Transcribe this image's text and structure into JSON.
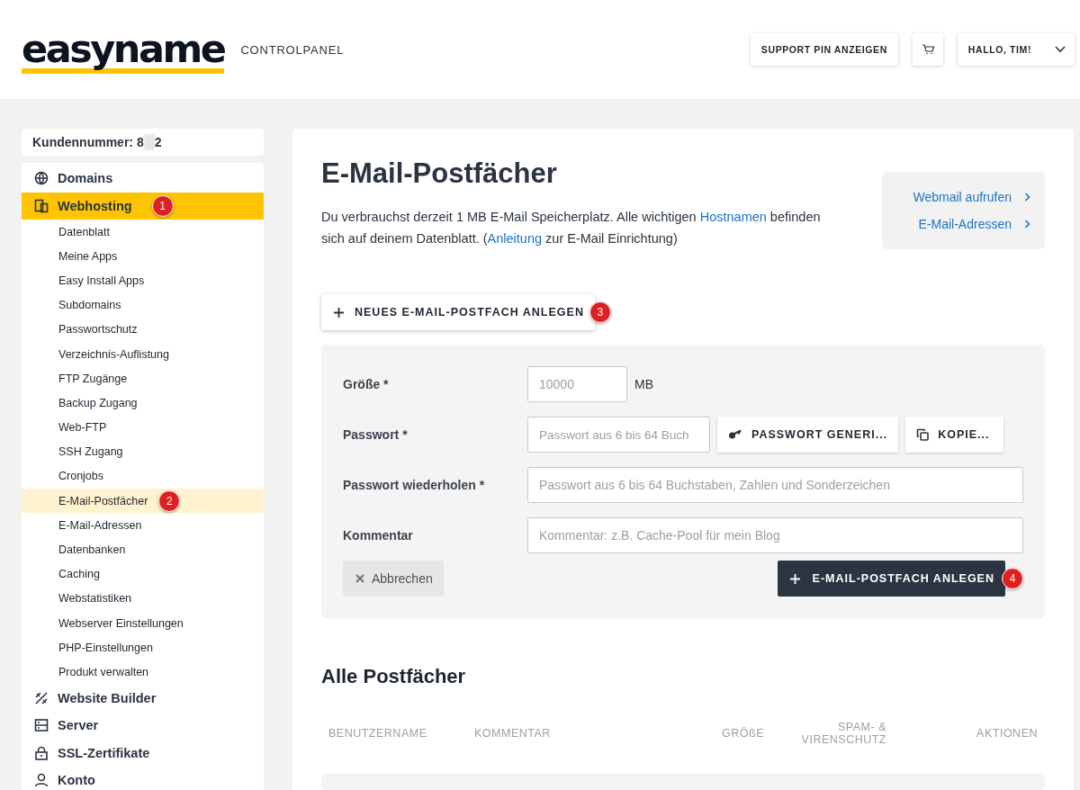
{
  "header": {
    "logo": "easyname",
    "product": "CONTROLPANEL",
    "buttons": [
      {
        "kind": "text",
        "label": "SUPPORT PIN ANZEIGEN"
      },
      {
        "kind": "cart"
      },
      {
        "kind": "menu",
        "label": "HALLO, TIM!"
      }
    ]
  },
  "sidebar": {
    "customer_label": "Kundennummer: 8",
    "customer_suffix": "2",
    "items": [
      {
        "label": "Domains",
        "kind": "globe",
        "selected": false
      },
      {
        "label": "Webhosting",
        "kind": "pages",
        "selected": true,
        "marker": "1",
        "children": [
          {
            "label": "Datenblatt",
            "selected": false
          },
          {
            "label": "Meine Apps",
            "selected": false
          },
          {
            "label": "Easy Install Apps",
            "selected": false
          },
          {
            "label": "Subdomains",
            "selected": false
          },
          {
            "label": "Passwortschutz",
            "selected": false
          },
          {
            "label": "Verzeichnis-Auflistung",
            "selected": false
          },
          {
            "label": "FTP Zugänge",
            "selected": false
          },
          {
            "label": "Backup Zugang",
            "selected": false
          },
          {
            "label": "Web-FTP",
            "selected": false
          },
          {
            "label": "SSH Zugang",
            "selected": false
          },
          {
            "label": "Cronjobs",
            "selected": false
          },
          {
            "label": "E-Mail-Postfächer",
            "selected": true,
            "marker": "2"
          },
          {
            "label": "E-Mail-Adressen",
            "selected": false
          },
          {
            "label": "Datenbanken",
            "selected": false
          },
          {
            "label": "Caching",
            "selected": false
          },
          {
            "label": "Webstatistiken",
            "selected": false
          },
          {
            "label": "Webserver Einstellungen",
            "selected": false
          },
          {
            "label": "PHP-Einstellungen",
            "selected": false
          },
          {
            "label": "Produkt verwalten",
            "selected": false
          }
        ]
      },
      {
        "label": "Website Builder",
        "kind": "tools",
        "selected": false
      },
      {
        "label": "Server",
        "kind": "server",
        "selected": false
      },
      {
        "label": "SSL-Zertifikate",
        "kind": "lock",
        "selected": false
      },
      {
        "label": "Konto",
        "kind": "user",
        "selected": false
      }
    ]
  },
  "main": {
    "title": "E-Mail-Postfächer",
    "intro": [
      {
        "kind": "text",
        "text": "Du verbrauchst derzeit 1 MB E-Mail Speicherplatz. Alle wichtigen "
      },
      {
        "kind": "link",
        "text": "Hostnamen"
      },
      {
        "kind": "text",
        "text": " befinden sich auf deinem Datenblatt. ("
      },
      {
        "kind": "link",
        "text": "Anleitung"
      },
      {
        "kind": "text",
        "text": " zur E-Mail Einrichtung)"
      }
    ],
    "quick_links": [
      "Webmail aufrufen",
      "E-Mail-Adressen"
    ],
    "new_button": {
      "label": "NEUES E-MAIL-POSTFACH ANLEGEN",
      "marker": "3"
    },
    "form": {
      "rows": [
        {
          "kind": "size",
          "label": "Größe *",
          "placeholder": "10000",
          "unit": "MB"
        },
        {
          "kind": "password",
          "label": "Passwort *",
          "placeholder": "Passwort aus 6 bis 64 Buch",
          "generate": "PASSWORT GENERI...",
          "copy": "KOPIE..."
        },
        {
          "kind": "text",
          "label": "Passwort wiederholen *",
          "placeholder": "Passwort aus 6 bis 64 Buchstaben, Zahlen und Sonderzeichen"
        },
        {
          "kind": "text",
          "label": "Kommentar",
          "placeholder": "Kommentar: z.B. Cache-Pool für mein Blog"
        }
      ],
      "cancel": "Abbrechen",
      "submit": {
        "label": "E-MAIL-POSTFACH ANLEGEN",
        "marker": "4"
      }
    },
    "list_title": "Alle Postfächer",
    "table": {
      "columns": [
        "BENUTZERNAME",
        "KOMMENTAR",
        "GRÖßE",
        "SPAM- & VIRENSCHUTZ",
        "AKTIONEN"
      ]
    }
  }
}
